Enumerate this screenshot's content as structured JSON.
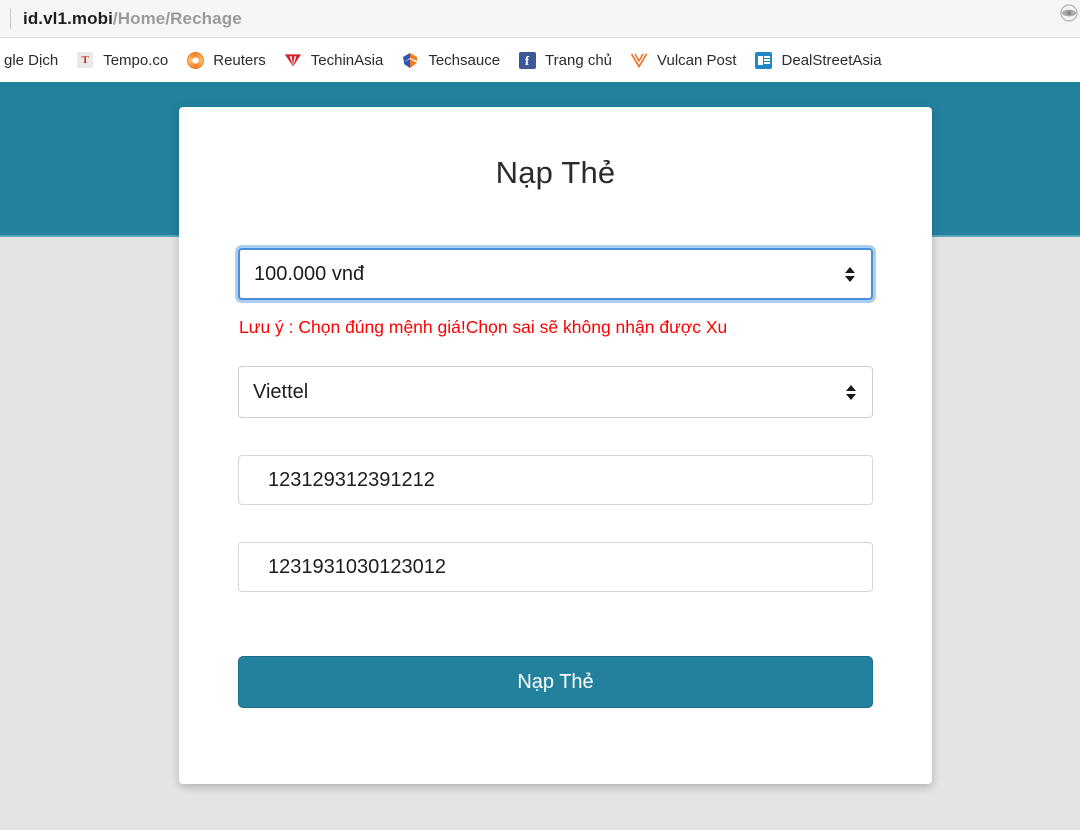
{
  "browser": {
    "url": {
      "host": "id.vl1.mobi",
      "path": "/Home/Rechage"
    },
    "bookmarks": [
      {
        "label": "gle Dịch",
        "icon": "google-translate-icon",
        "icon_kind": "none",
        "clipped": true
      },
      {
        "label": "Tempo.co",
        "icon": "tempo-icon",
        "icon_kind": "tempo",
        "glyph": "T"
      },
      {
        "label": "Reuters",
        "icon": "reuters-icon",
        "icon_kind": "reuters",
        "glyph": ""
      },
      {
        "label": "TechinAsia",
        "icon": "techinasia-icon",
        "icon_kind": "techinasia",
        "glyph": "TΛ"
      },
      {
        "label": "Techsauce",
        "icon": "techsauce-icon",
        "icon_kind": "techsauce",
        "glyph": "S"
      },
      {
        "label": "Trang chủ",
        "icon": "facebook-icon",
        "icon_kind": "facebook",
        "glyph": "f"
      },
      {
        "label": "Vulcan Post",
        "icon": "vulcan-post-icon",
        "icon_kind": "vulcan",
        "glyph": "V"
      },
      {
        "label": "DealStreetAsia",
        "icon": "dealstreetasia-icon",
        "icon_kind": "dsa",
        "glyph": ""
      }
    ]
  },
  "theme": {
    "brand_teal": "#23819E",
    "page_background": "#E4E4E4",
    "warning_red": "#FE0000",
    "focus_blue": "#4A90D9"
  },
  "card": {
    "title": "Nạp Thẻ",
    "amount_select": {
      "value": "100.000 vnđ",
      "focused": true
    },
    "warning": "Lưu ý : Chọn đúng mệnh giá!Chọn sai sẽ không nhận được Xu",
    "carrier_select": {
      "value": "Viettel"
    },
    "serial_input": {
      "value": "123129312391212",
      "placeholder": ""
    },
    "code_input": {
      "value": "1231931030123012",
      "placeholder": ""
    },
    "submit_label": "Nạp Thẻ"
  }
}
